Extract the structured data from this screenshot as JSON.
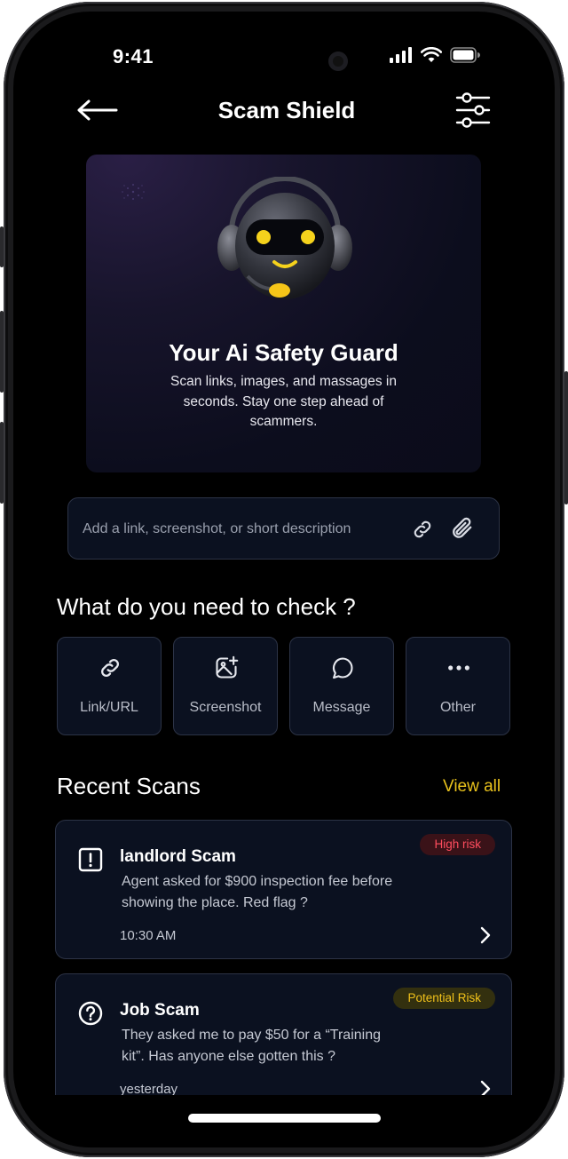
{
  "status_bar": {
    "time": "9:41"
  },
  "header": {
    "title": "Scam Shield",
    "back_icon": "arrow-left-icon",
    "filter_icon": "sliders-icon"
  },
  "hero": {
    "title": "Your Ai Safety Guard",
    "subtitle": "Scan links, images, and massages in seconds. Stay one step ahead of scammers.",
    "illustration": "robot-headset-icon"
  },
  "input": {
    "placeholder": "Add a link, screenshot, or short description",
    "value": ""
  },
  "check_section": {
    "title": "What do you need to check ?",
    "items": [
      {
        "label": "Link/URL",
        "icon": "link-icon"
      },
      {
        "label": "Screenshot",
        "icon": "image-add-icon"
      },
      {
        "label": "Message",
        "icon": "chat-bubble-icon"
      },
      {
        "label": "Other",
        "icon": "more-dots-icon"
      }
    ]
  },
  "recent": {
    "title": "Recent Scans",
    "view_all": "View all",
    "scans": [
      {
        "name": "landlord Scam",
        "description": "Agent asked for $900 inspection fee before showing the place. Red flag ?",
        "time": "10:30 AM",
        "badge": "High risk",
        "badge_color": "#ff4d5e",
        "icon": "alert-square-icon"
      },
      {
        "name": "Job Scam",
        "description": "They asked me to pay $50 for a “Training kit”. Has anyone else gotten this ?",
        "time": "yesterday",
        "badge": "Potential Risk",
        "badge_color": "#f2c21a",
        "icon": "question-circle-icon"
      }
    ]
  },
  "colors": {
    "background": "#000000",
    "card": "#0b1120",
    "accent": "#e9c21c",
    "high_risk": "#ff4d5e"
  }
}
